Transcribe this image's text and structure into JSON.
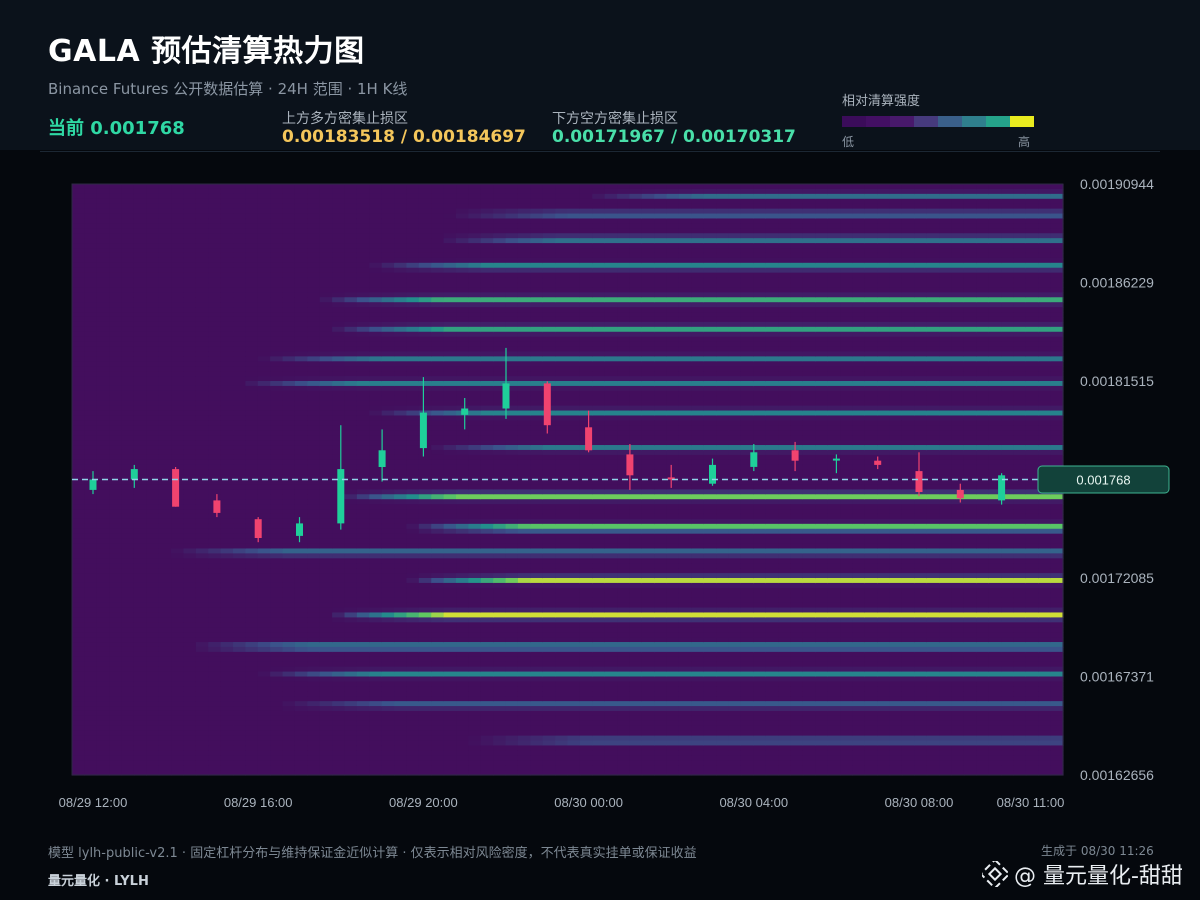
{
  "header": {
    "title": "GALA 预估清算热力图",
    "subtitle": "Binance Futures 公开数据估算 · 24H 范围 · 1H K线",
    "current": "当前 0.001768",
    "upper_zone_label": "上方多方密集止损区",
    "upper_zone_value": "0.00183518 / 0.00184697",
    "lower_zone_label": "下方空方密集止损区",
    "lower_zone_value": "0.00171967 / 0.00170317",
    "legend_title": "相对清算强度",
    "legend_low": "低",
    "legend_high": "高",
    "legend_colors": [
      "#3b0c5a",
      "#430f63",
      "#48196b",
      "#463a7d",
      "#3a5f8a",
      "#2f7f8d",
      "#25a38a",
      "#eaeb1f"
    ]
  },
  "footer": {
    "note": "模型 lylh-public-v2.1 · 固定杠杆分布与维持保证金近似计算 · 仅表示相对风险密度，不代表真实挂单或保证收益",
    "brand": "量元量化 · LYLH",
    "generated": "生成于 08/30 11:26",
    "watermark": "@ 量元量化-甜甜"
  },
  "chart_data": {
    "type": "heatmap",
    "overlay": "candlestick",
    "x_ticks": [
      "08/29 12:00",
      "08/29 16:00",
      "08/29 20:00",
      "08/30 00:00",
      "08/30 04:00",
      "08/30 08:00",
      "08/30 11:00"
    ],
    "y_ticks": [
      "0.00190944",
      "0.00186229",
      "0.00181515",
      "0.00176800",
      "0.00172085",
      "0.00167371",
      "0.00162656"
    ],
    "y_tick_labels": [
      "0.00190944",
      "0.00186229",
      "0.00181515",
      "",
      "0.00172085",
      "0.00167371",
      "0.00162656"
    ],
    "ylim": [
      0.00162656,
      0.00190944
    ],
    "current_price": 0.001768,
    "current_price_label": "0.001768",
    "up_color": "#1fcf9a",
    "down_color": "#f0436f",
    "candles": [
      {
        "t": "08/29 12:00",
        "o": 0.001763,
        "h": 0.001772,
        "l": 0.001761,
        "c": 0.001768
      },
      {
        "t": "08/29 13:00",
        "o": 0.001768,
        "h": 0.001775,
        "l": 0.001764,
        "c": 0.001773
      },
      {
        "t": "08/29 14:00",
        "o": 0.001773,
        "h": 0.001774,
        "l": 0.001755,
        "c": 0.001755
      },
      {
        "t": "08/29 15:00",
        "o": 0.001758,
        "h": 0.001761,
        "l": 0.00175,
        "c": 0.001752
      },
      {
        "t": "08/29 16:00",
        "o": 0.001749,
        "h": 0.00175,
        "l": 0.001738,
        "c": 0.00174
      },
      {
        "t": "08/29 17:00",
        "o": 0.001741,
        "h": 0.00175,
        "l": 0.001738,
        "c": 0.001747
      },
      {
        "t": "08/29 18:00",
        "o": 0.001747,
        "h": 0.001794,
        "l": 0.001744,
        "c": 0.001773
      },
      {
        "t": "08/29 19:00",
        "o": 0.001774,
        "h": 0.001792,
        "l": 0.001767,
        "c": 0.001782
      },
      {
        "t": "08/29 20:00",
        "o": 0.001783,
        "h": 0.001817,
        "l": 0.001779,
        "c": 0.0018
      },
      {
        "t": "08/29 21:00",
        "o": 0.001799,
        "h": 0.001807,
        "l": 0.001792,
        "c": 0.001802
      },
      {
        "t": "08/29 22:00",
        "o": 0.001802,
        "h": 0.001831,
        "l": 0.001797,
        "c": 0.001814
      },
      {
        "t": "08/29 23:00",
        "o": 0.001814,
        "h": 0.001815,
        "l": 0.00179,
        "c": 0.001794
      },
      {
        "t": "08/30 00:00",
        "o": 0.001793,
        "h": 0.001801,
        "l": 0.001781,
        "c": 0.001782
      },
      {
        "t": "08/30 01:00",
        "o": 0.00178,
        "h": 0.001785,
        "l": 0.001763,
        "c": 0.00177
      },
      {
        "t": "08/30 02:00",
        "o": 0.001769,
        "h": 0.001775,
        "l": 0.001764,
        "c": 0.001768
      },
      {
        "t": "08/30 03:00",
        "o": 0.001766,
        "h": 0.001778,
        "l": 0.001765,
        "c": 0.001775
      },
      {
        "t": "08/30 04:00",
        "o": 0.001774,
        "h": 0.001785,
        "l": 0.001772,
        "c": 0.001781
      },
      {
        "t": "08/30 05:00",
        "o": 0.001782,
        "h": 0.001786,
        "l": 0.001772,
        "c": 0.001777
      },
      {
        "t": "08/30 06:00",
        "o": 0.001778,
        "h": 0.00178,
        "l": 0.001771,
        "c": 0.001778
      },
      {
        "t": "08/30 07:00",
        "o": 0.001777,
        "h": 0.001779,
        "l": 0.001773,
        "c": 0.001775
      },
      {
        "t": "08/30 08:00",
        "o": 0.001772,
        "h": 0.001781,
        "l": 0.00176,
        "c": 0.001762
      },
      {
        "t": "08/30 09:00",
        "o": 0.001763,
        "h": 0.001766,
        "l": 0.001757,
        "c": 0.001759
      },
      {
        "t": "08/30 10:00",
        "o": 0.001758,
        "h": 0.001771,
        "l": 0.001756,
        "c": 0.00177
      }
    ],
    "heat_bands": [
      {
        "p": 0.001904,
        "s": 0.52,
        "w": 1.2e-06,
        "k": 0.4
      },
      {
        "p": 0.001895,
        "s": 0.38,
        "w": 1.4e-06,
        "k": 0.35
      },
      {
        "p": 0.001883,
        "s": 0.37,
        "w": 1.4e-06,
        "k": 0.45
      },
      {
        "p": 0.00187,
        "s": 0.3,
        "w": 1.4e-06,
        "k": 0.52
      },
      {
        "p": 0.001854,
        "s": 0.25,
        "w": 1.5e-06,
        "k": 0.62
      },
      {
        "p": 0.00184,
        "s": 0.26,
        "w": 1.5e-06,
        "k": 0.58
      },
      {
        "p": 0.001826,
        "s": 0.19,
        "w": 1.3e-06,
        "k": 0.4
      },
      {
        "p": 0.001814,
        "s": 0.17,
        "w": 1.4e-06,
        "k": 0.42
      },
      {
        "p": 0.0018,
        "s": 0.3,
        "w": 1.4e-06,
        "k": 0.45
      },
      {
        "p": 0.001783,
        "s": 0.36,
        "w": 1.3e-06,
        "k": 0.42
      },
      {
        "p": 0.00176,
        "s": 0.27,
        "w": 1.5e-06,
        "k": 0.82
      },
      {
        "p": 0.001745,
        "s": 0.34,
        "w": 1.6e-06,
        "k": 0.86
      },
      {
        "p": 0.001733,
        "s": 0.1,
        "w": 1.3e-06,
        "k": 0.45
      },
      {
        "p": 0.00172,
        "s": 0.34,
        "w": 1.4e-06,
        "k": 0.98
      },
      {
        "p": 0.001703,
        "s": 0.26,
        "w": 1.5e-06,
        "k": 0.98
      },
      {
        "p": 0.001688,
        "s": 0.12,
        "w": 1.5e-06,
        "k": 0.52
      },
      {
        "p": 0.001675,
        "s": 0.19,
        "w": 1.4e-06,
        "k": 0.45
      },
      {
        "p": 0.00166,
        "s": 0.21,
        "w": 1.3e-06,
        "k": 0.36
      },
      {
        "p": 0.001643,
        "s": 0.4,
        "w": 1.4e-06,
        "k": 0.34
      }
    ]
  }
}
